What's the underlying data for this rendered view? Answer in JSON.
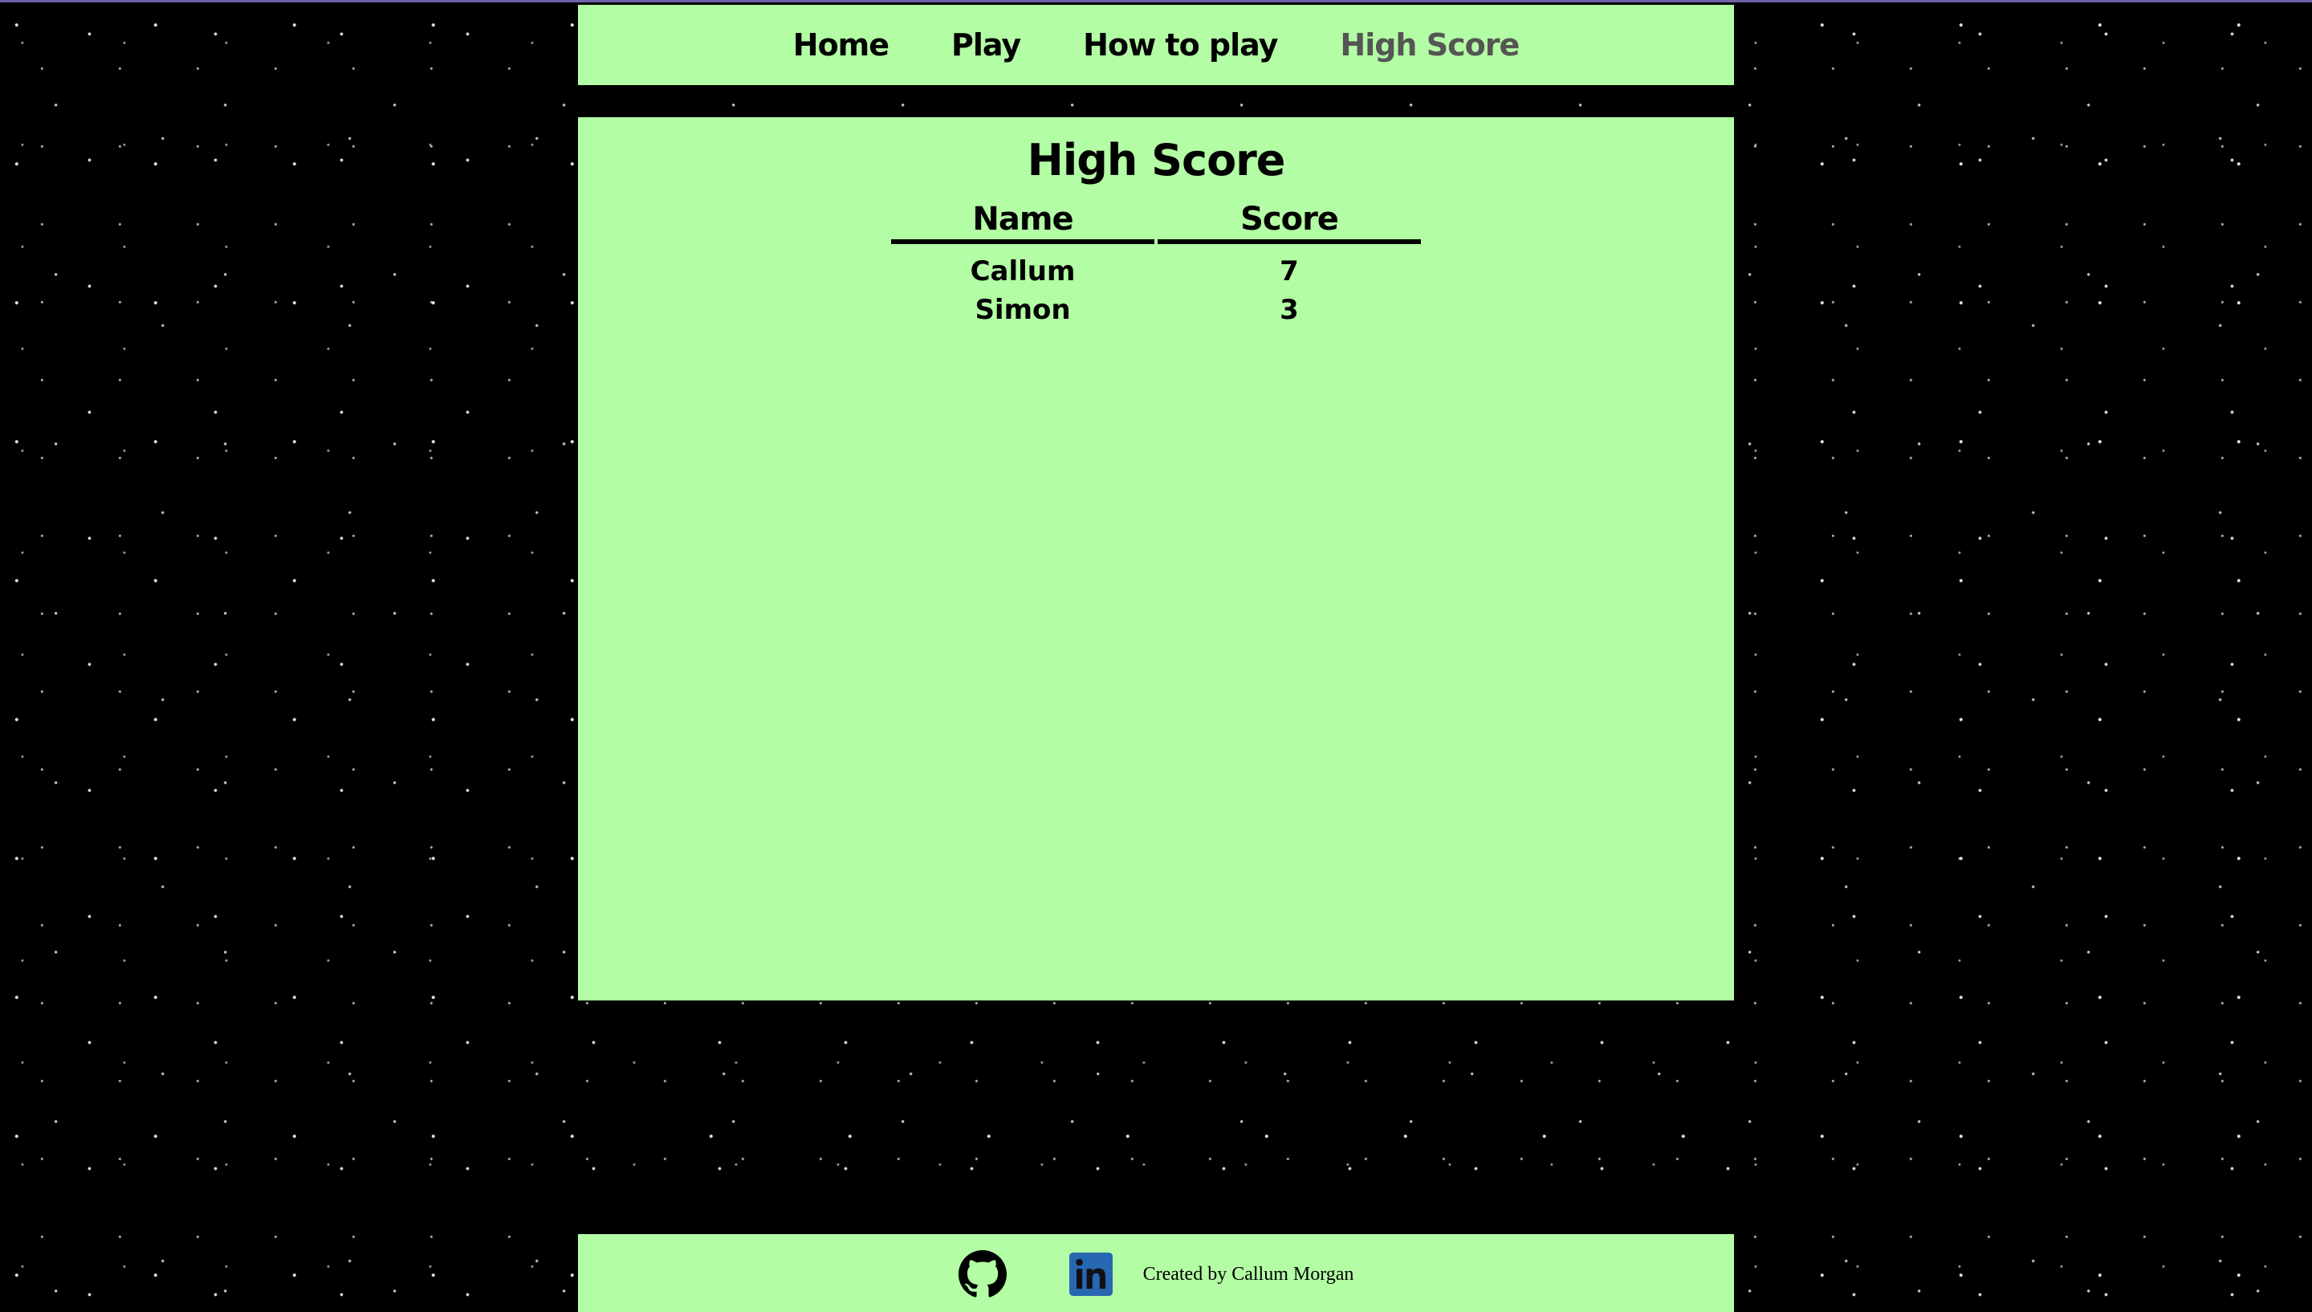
{
  "nav": {
    "items": [
      {
        "label": "Home",
        "active": false
      },
      {
        "label": "Play",
        "active": false
      },
      {
        "label": "How to play",
        "active": false
      },
      {
        "label": "High Score",
        "active": true
      }
    ]
  },
  "main": {
    "title": "High Score",
    "table": {
      "headers": [
        "Name",
        "Score"
      ],
      "rows": [
        {
          "name": "Callum",
          "score": "7"
        },
        {
          "name": "Simon",
          "score": "3"
        }
      ]
    }
  },
  "footer": {
    "icons": [
      "github-icon",
      "linkedin-icon"
    ],
    "credit": "Created by Callum Morgan"
  },
  "colors": {
    "panel_bg": "#b3fda4",
    "active_nav": "#555555",
    "linkedin_blue": "#2867b2",
    "background": "#000000"
  }
}
